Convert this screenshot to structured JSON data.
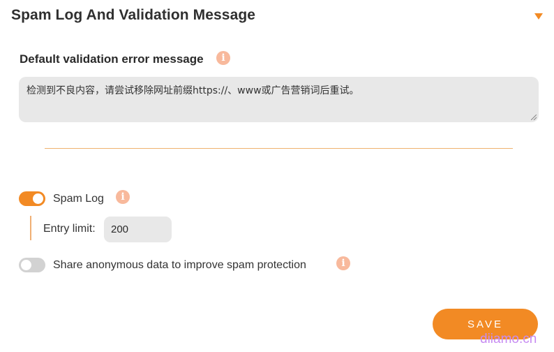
{
  "section": {
    "title": "Spam Log And Validation Message",
    "toggle_icon": "triangle-down-icon"
  },
  "validation": {
    "label": "Default validation error message",
    "info_icon": "info-icon",
    "message": "检测到不良内容，请尝试移除网址前缀https://、www或广告营销词后重试。"
  },
  "spam_log": {
    "enabled": true,
    "label": "Spam Log",
    "info_icon": "info-icon",
    "entry_limit_label": "Entry limit:",
    "entry_limit_value": "200"
  },
  "share_data": {
    "enabled": false,
    "label": "Share anonymous data to improve spam protection",
    "info_icon": "info-icon"
  },
  "actions": {
    "save_label": "SAVE"
  },
  "watermark": "diiamo.cn",
  "colors": {
    "accent": "#f28a24",
    "info_icon": "#f8b99c",
    "input_bg": "#e8e8e8",
    "toggle_off": "#d2d2d2"
  }
}
